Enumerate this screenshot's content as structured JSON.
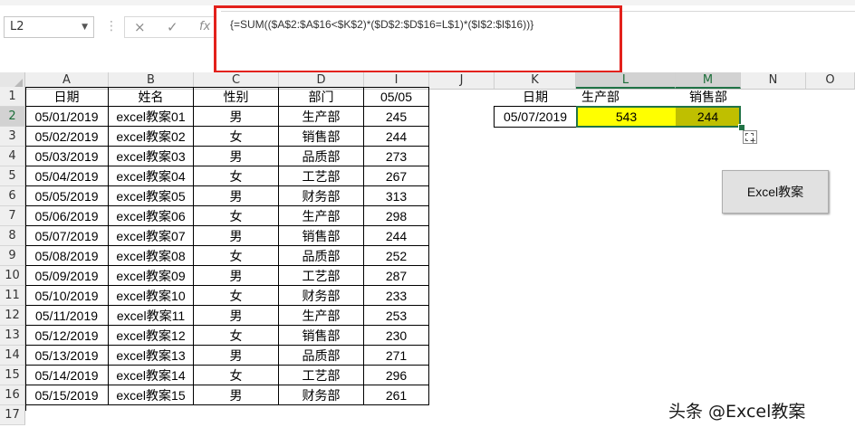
{
  "formula_bar": {
    "name_box": "L2",
    "cancel_icon": "×",
    "enter_icon": "✓",
    "fx_label": "fx",
    "formula": "{=SUM(($A$2:$A$16<$K$2)*($D$2:$D$16=L$1)*($I$2:$I$16))}"
  },
  "columns": [
    "A",
    "B",
    "C",
    "D",
    "I",
    "J",
    "K",
    "L",
    "M",
    "N",
    "O"
  ],
  "selected_column_labels": [
    "L",
    "M"
  ],
  "rows": [
    "1",
    "2",
    "3",
    "4",
    "5",
    "6",
    "7",
    "8",
    "9",
    "10",
    "11",
    "12",
    "13",
    "14",
    "15",
    "16",
    "17"
  ],
  "table": {
    "headers": [
      "日期",
      "姓名",
      "性别",
      "部门",
      "05/05"
    ],
    "records": [
      [
        "05/01/2019",
        "excel教案01",
        "男",
        "生产部",
        "245"
      ],
      [
        "05/02/2019",
        "excel教案02",
        "女",
        "销售部",
        "244"
      ],
      [
        "05/03/2019",
        "excel教案03",
        "男",
        "品质部",
        "273"
      ],
      [
        "05/04/2019",
        "excel教案04",
        "女",
        "工艺部",
        "267"
      ],
      [
        "05/05/2019",
        "excel教案05",
        "男",
        "财务部",
        "313"
      ],
      [
        "05/06/2019",
        "excel教案06",
        "女",
        "生产部",
        "298"
      ],
      [
        "05/07/2019",
        "excel教案07",
        "男",
        "销售部",
        "244"
      ],
      [
        "05/08/2019",
        "excel教案08",
        "女",
        "品质部",
        "252"
      ],
      [
        "05/09/2019",
        "excel教案09",
        "男",
        "工艺部",
        "287"
      ],
      [
        "05/10/2019",
        "excel教案10",
        "女",
        "财务部",
        "233"
      ],
      [
        "05/11/2019",
        "excel教案11",
        "男",
        "生产部",
        "253"
      ],
      [
        "05/12/2019",
        "excel教案12",
        "女",
        "销售部",
        "230"
      ],
      [
        "05/13/2019",
        "excel教案13",
        "男",
        "品质部",
        "271"
      ],
      [
        "05/14/2019",
        "excel教案14",
        "女",
        "工艺部",
        "296"
      ],
      [
        "05/15/2019",
        "excel教案15",
        "男",
        "财务部",
        "261"
      ]
    ]
  },
  "summary": {
    "k1": "日期",
    "l1": "生产部",
    "m1": "销售部",
    "k2": "05/07/2019",
    "l2": "543",
    "m2": "244"
  },
  "macro_button_label": "Excel教案",
  "watermark": "头条 @Excel教案",
  "colors": {
    "highlight_border": "#e3211c",
    "selection": "#217346",
    "yellow_fill": "#ffff00",
    "olive_fill": "#bfbf00"
  }
}
